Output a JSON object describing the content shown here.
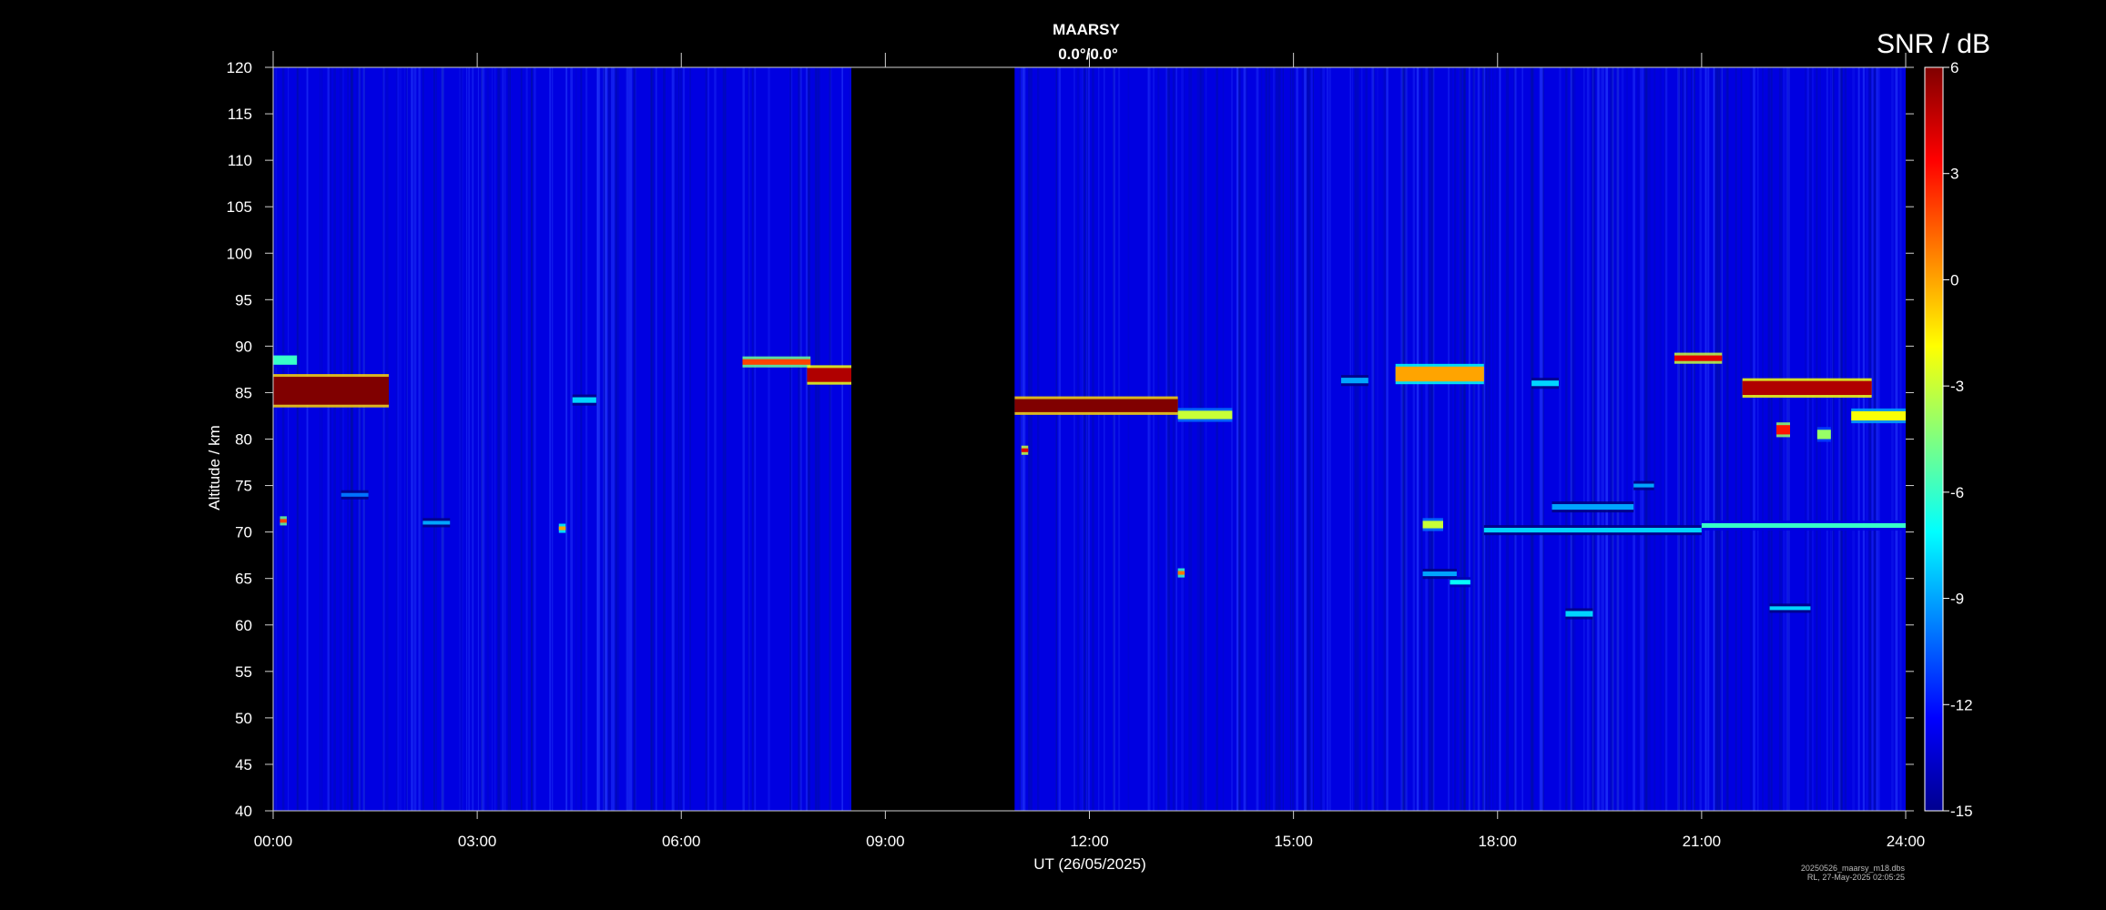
{
  "chart_data": {
    "type": "heatmap",
    "title": "MAARSY",
    "subtitle": "0.0°/0.0°",
    "xlabel": "UT (26/05/2025)",
    "ylabel": "Altitude / km",
    "colorbar_label": "SNR / dB",
    "xlim": [
      0,
      24
    ],
    "ylim": [
      40,
      120
    ],
    "clim": [
      -15,
      6
    ],
    "x_ticks": [
      0,
      3,
      6,
      9,
      12,
      15,
      18,
      21,
      24
    ],
    "x_tick_labels": [
      "00:00",
      "03:00",
      "06:00",
      "09:00",
      "12:00",
      "15:00",
      "18:00",
      "21:00",
      "24:00"
    ],
    "y_ticks": [
      40,
      45,
      50,
      55,
      60,
      65,
      70,
      75,
      80,
      85,
      90,
      95,
      100,
      105,
      110,
      115,
      120
    ],
    "y_tick_labels": [
      "40",
      "45",
      "50",
      "55",
      "60",
      "65",
      "70",
      "75",
      "80",
      "85",
      "90",
      "95",
      "100",
      "105",
      "110",
      "115",
      "120"
    ],
    "colorbar_ticks": [
      6,
      3,
      0,
      -3,
      -6,
      -9,
      -12,
      -15
    ],
    "colorbar_tick_labels": [
      "6",
      "3",
      "0",
      "-3",
      "-6",
      "-9",
      "-12",
      "-15"
    ],
    "background_snr": -13,
    "data_gaps": [
      {
        "t_start": 8.5,
        "t_end": 10.9
      }
    ],
    "echo_layers": [
      {
        "t_start": 0.0,
        "t_end": 1.7,
        "alt": 85.2,
        "thickness": 3.0,
        "snr": 6
      },
      {
        "t_start": 0.0,
        "t_end": 0.35,
        "alt": 88.5,
        "thickness": 1.0,
        "snr": -6
      },
      {
        "t_start": 4.4,
        "t_end": 4.75,
        "alt": 84.2,
        "thickness": 0.6,
        "snr": -8
      },
      {
        "t_start": 6.9,
        "t_end": 7.9,
        "alt": 88.3,
        "thickness": 0.6,
        "snr": 2
      },
      {
        "t_start": 7.85,
        "t_end": 8.5,
        "alt": 86.9,
        "thickness": 1.5,
        "snr": 5
      },
      {
        "t_start": 10.9,
        "t_end": 13.3,
        "alt": 83.6,
        "thickness": 1.4,
        "snr": 6
      },
      {
        "t_start": 13.3,
        "t_end": 14.1,
        "alt": 82.6,
        "thickness": 0.9,
        "snr": -3
      },
      {
        "t_start": 15.7,
        "t_end": 16.1,
        "alt": 86.3,
        "thickness": 0.6,
        "snr": -9
      },
      {
        "t_start": 16.5,
        "t_end": 17.8,
        "alt": 87.0,
        "thickness": 1.6,
        "snr": 0
      },
      {
        "t_start": 18.5,
        "t_end": 18.9,
        "alt": 86.0,
        "thickness": 0.6,
        "snr": -8
      },
      {
        "t_start": 20.6,
        "t_end": 21.3,
        "alt": 88.7,
        "thickness": 0.6,
        "snr": 4
      },
      {
        "t_start": 21.6,
        "t_end": 23.5,
        "alt": 85.5,
        "thickness": 1.5,
        "snr": 5
      },
      {
        "t_start": 23.2,
        "t_end": 24.0,
        "alt": 82.5,
        "thickness": 1.0,
        "snr": -2
      },
      {
        "t_start": 22.1,
        "t_end": 22.3,
        "alt": 81.0,
        "thickness": 1.0,
        "snr": 3
      },
      {
        "t_start": 22.7,
        "t_end": 22.9,
        "alt": 80.5,
        "thickness": 1.0,
        "snr": -4
      },
      {
        "t_start": 16.9,
        "t_end": 17.2,
        "alt": 70.8,
        "thickness": 0.8,
        "snr": -3
      },
      {
        "t_start": 17.8,
        "t_end": 21.0,
        "alt": 70.2,
        "thickness": 0.5,
        "snr": -8
      },
      {
        "t_start": 21.0,
        "t_end": 24.0,
        "alt": 70.7,
        "thickness": 0.5,
        "snr": -6
      },
      {
        "t_start": 18.8,
        "t_end": 20.0,
        "alt": 72.7,
        "thickness": 0.6,
        "snr": -9
      },
      {
        "t_start": 19.0,
        "t_end": 19.4,
        "alt": 61.2,
        "thickness": 0.6,
        "snr": -8
      },
      {
        "t_start": 16.9,
        "t_end": 17.4,
        "alt": 65.5,
        "thickness": 0.5,
        "snr": -9
      },
      {
        "t_start": 17.3,
        "t_end": 17.6,
        "alt": 64.6,
        "thickness": 0.5,
        "snr": -7
      },
      {
        "t_start": 22.0,
        "t_end": 22.6,
        "alt": 61.8,
        "thickness": 0.4,
        "snr": -8
      },
      {
        "t_start": 20.0,
        "t_end": 20.3,
        "alt": 75.0,
        "thickness": 0.4,
        "snr": -9
      },
      {
        "t_start": 1.0,
        "t_end": 1.4,
        "alt": 74.0,
        "thickness": 0.4,
        "snr": -10
      },
      {
        "t_start": 0.1,
        "t_end": 0.2,
        "alt": 71.2,
        "thickness": 0.4,
        "snr": 2
      },
      {
        "t_start": 2.2,
        "t_end": 2.6,
        "alt": 71.0,
        "thickness": 0.4,
        "snr": -9
      },
      {
        "t_start": 4.2,
        "t_end": 4.3,
        "alt": 70.4,
        "thickness": 0.4,
        "snr": 0
      },
      {
        "t_start": 13.3,
        "t_end": 13.4,
        "alt": 65.6,
        "thickness": 0.4,
        "snr": 1
      },
      {
        "t_start": 11.0,
        "t_end": 11.1,
        "alt": 78.8,
        "thickness": 0.4,
        "snr": 4
      }
    ]
  },
  "footer": {
    "filename": "20250526_maarsy_m18.dbs",
    "stamp": "RL, 27-May-2025 02:05:25"
  }
}
